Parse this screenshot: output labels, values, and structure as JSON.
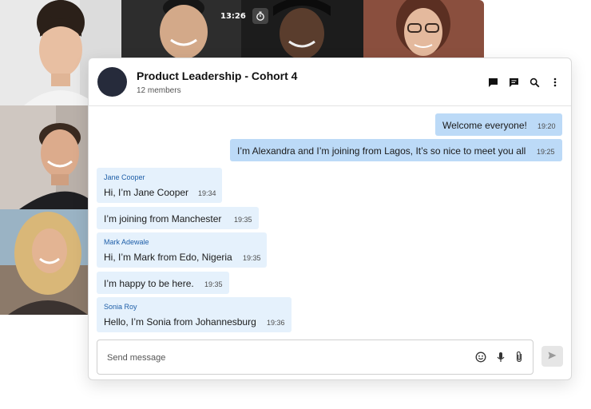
{
  "video": {
    "timer": "13:26",
    "timer_icon": "stopwatch-icon"
  },
  "chat": {
    "title": "Product Leadership - Cohort 4",
    "members": "12 members",
    "header_icons": [
      "chat-bubble-icon",
      "message-icon",
      "search-icon",
      "more-vertical-icon"
    ],
    "messages": [
      {
        "direction": "outgoing",
        "text": "Welcome everyone!",
        "time": "19:20"
      },
      {
        "direction": "outgoing",
        "text": "I’m Alexandra and I’m joining from Lagos, It’s so nice to meet you all",
        "time": "19:25"
      },
      {
        "direction": "incoming",
        "sender": "Jane Cooper",
        "text": "Hi, I’m Jane Cooper",
        "time": "19:34"
      },
      {
        "direction": "incoming",
        "text": "I’m joining from Manchester",
        "time": "19:35"
      },
      {
        "direction": "incoming",
        "sender": "Mark Adewale",
        "text": "Hi, I’m Mark from Edo, Nigeria",
        "time": "19:35"
      },
      {
        "direction": "incoming",
        "text": "I’m happy to be here.",
        "time": "19:35"
      },
      {
        "direction": "incoming",
        "sender": "Sonia Roy",
        "text": "Hello, I’m Sonia from Johannesburg",
        "time": "19:36"
      }
    ],
    "composer": {
      "placeholder": "Send message",
      "icons": [
        "emoji-icon",
        "microphone-icon",
        "paperclip-icon"
      ],
      "send_icon": "send-icon"
    }
  },
  "colors": {
    "outgoing_bubble": "#bcdaf7",
    "incoming_bubble": "#e5f1fc",
    "sender_name": "#1f5fa8",
    "avatar": "#262b3b"
  }
}
